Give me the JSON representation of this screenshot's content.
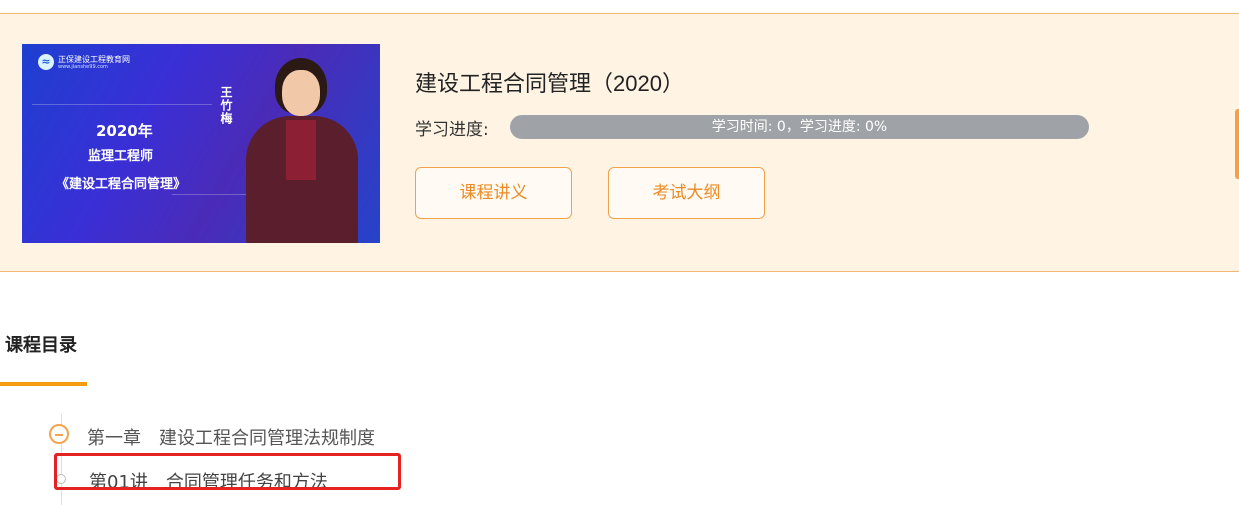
{
  "course": {
    "title": "建设工程合同管理（2020）",
    "progress_label": "学习进度:",
    "progress_text": "学习时间: 0，学习进度: 0%",
    "progress_percent": 0
  },
  "cover": {
    "brand": "正保建设工程教育网",
    "brand_url": "www.jianshe99.com",
    "year_text": "2020年",
    "exam_text": "监理工程师",
    "subject_text": "《建设工程合同管理》",
    "teacher_name": "王竹梅"
  },
  "buttons": {
    "handout": "课程讲义",
    "syllabus": "考试大纲"
  },
  "catalog": {
    "title": "课程目录",
    "chapter": "第一章　建设工程合同管理法规制度",
    "lesson": "第01讲　合同管理任务和方法"
  },
  "colors": {
    "accent": "#f39c12",
    "header_bg": "#fff4e4",
    "highlight": "#e52222"
  }
}
